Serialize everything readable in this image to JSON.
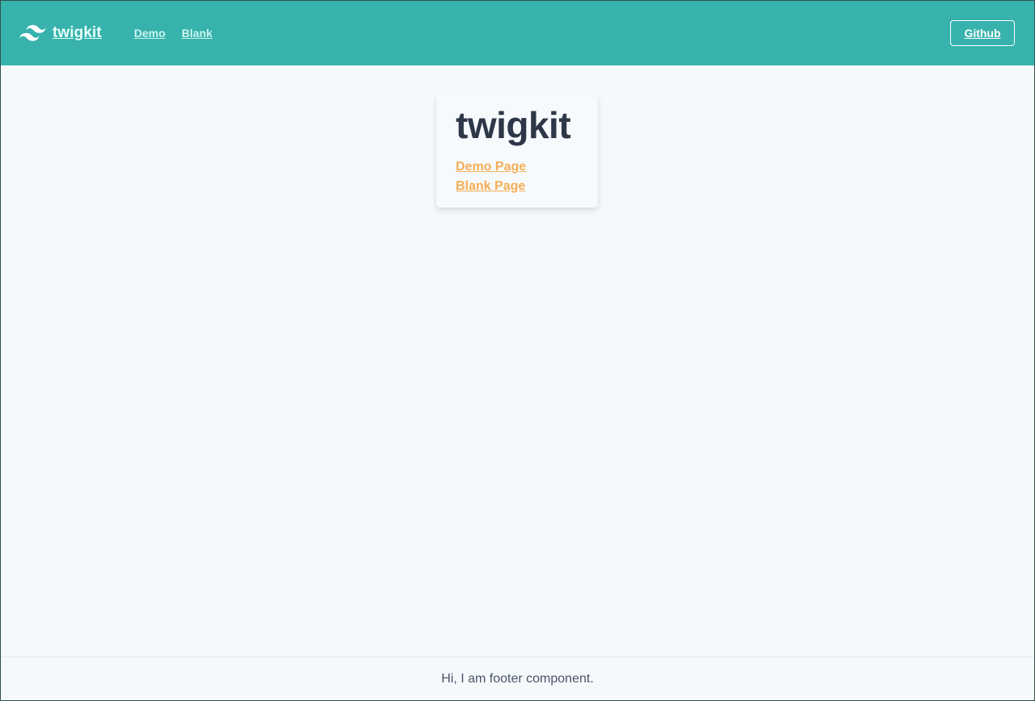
{
  "navbar": {
    "brand_name": "twigkit",
    "brand_icon": "tailwind-wave-icon",
    "links": [
      {
        "label": "Demo"
      },
      {
        "label": "Blank"
      }
    ],
    "github_label": "Github",
    "background_color": "#38b2ac"
  },
  "card": {
    "title": "twigkit",
    "links": [
      {
        "label": "Demo Page"
      },
      {
        "label": "Blank Page"
      }
    ],
    "link_color": "#f6ad55"
  },
  "footer": {
    "text": "Hi, I am footer component."
  }
}
